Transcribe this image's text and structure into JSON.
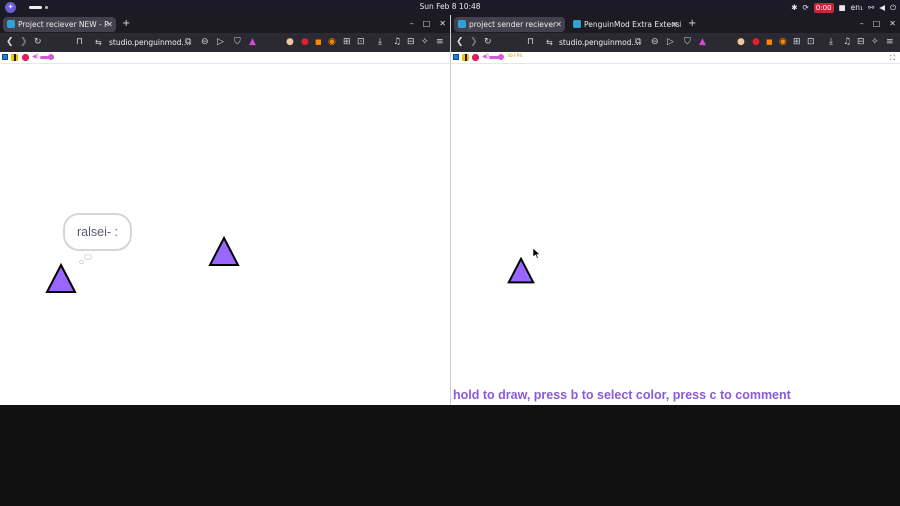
{
  "system_bar": {
    "clock": "Sun Feb 8  10:48",
    "recording_time": "0:00",
    "language": "en₁",
    "icons": [
      "app-menu-icon",
      "extensions-icon",
      "refresh-icon",
      "screen-record-icon",
      "network-icon",
      "volume-icon",
      "power-icon"
    ]
  },
  "left_window": {
    "tabs": [
      {
        "label": "Project reciever NEW - P"
      }
    ],
    "new_tab": "+",
    "url": "studio.penguinmod....",
    "window_controls": [
      "–",
      "□",
      "✕"
    ],
    "stage": {
      "speech_bubble": "ralsei- :",
      "sprites": [
        "triangle-sprite",
        "triangle-sprite"
      ]
    }
  },
  "right_window": {
    "tabs": [
      {
        "label": "project sender reciever"
      },
      {
        "label": "PenguinMod Extra Extensio"
      }
    ],
    "new_tab": "+",
    "url": "studio.penguinmod....",
    "window_controls": [
      "–",
      "□",
      "✕"
    ],
    "fps_label": "30 FPS",
    "stage": {
      "instruction": "hold to draw, press b to select color, press c to comment",
      "sprites": [
        "triangle-sprite"
      ]
    }
  },
  "colors": {
    "sprite_fill": "#9966ff",
    "hint_text": "#8a5bd6",
    "browser_dark": "#2b2a33",
    "tab_strip": "#1c1b22"
  }
}
